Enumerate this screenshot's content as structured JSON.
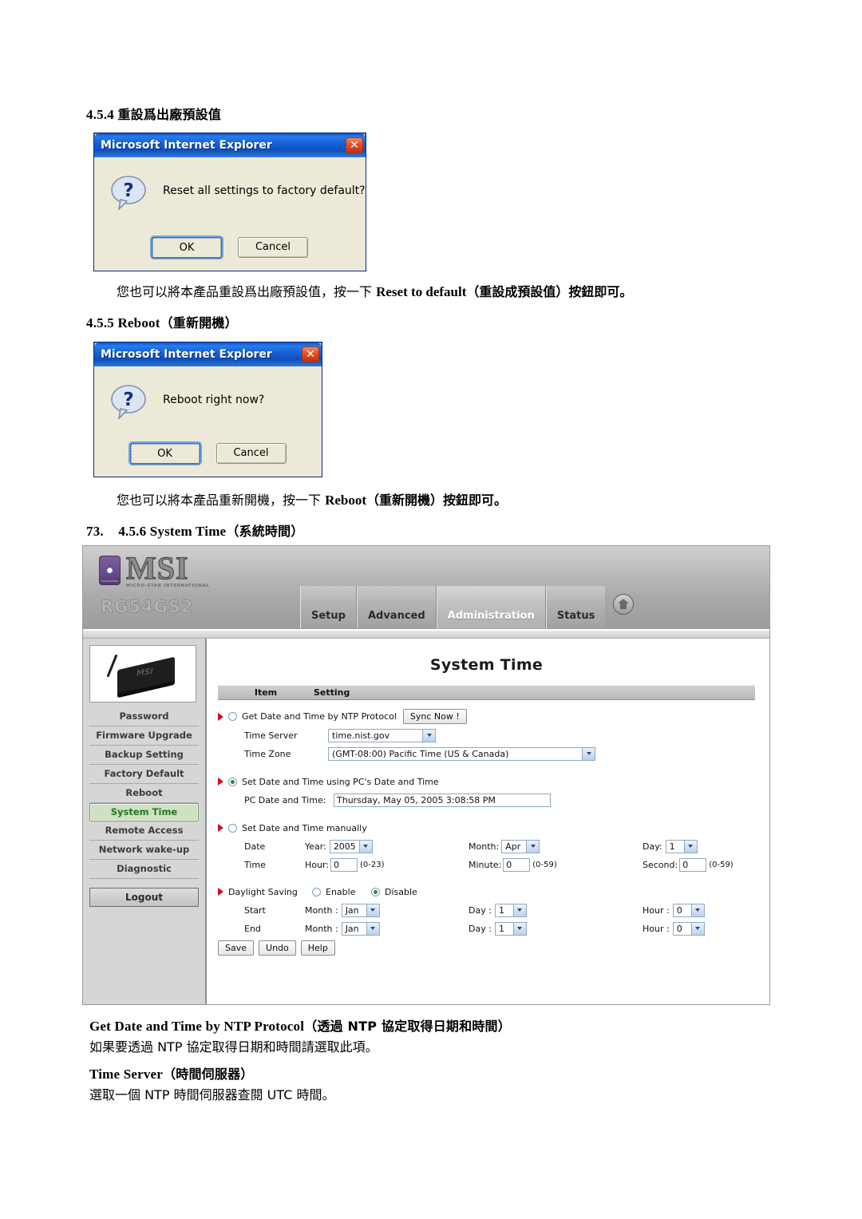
{
  "document": {
    "section_454_heading": "4.5.4 ",
    "section_454_heading_cjk": "重設爲出廠預設值",
    "para_454": "您也可以將本產品重設爲出廠預設值，按一下 ",
    "para_454_bold": "Reset to default",
    "para_454_tail": "（重設成預設值）按鈕即可。",
    "section_455_heading": "4.5.5 Reboot",
    "section_455_heading_cjk": "（重新開機）",
    "para_455": "您也可以將本產品重新開機，按一下 ",
    "para_455_bold": "Reboot",
    "para_455_tail": "（重新開機）按鈕即可。",
    "section_456_number": "73.",
    "section_456_heading": "4.5.6 System Time",
    "section_456_heading_cjk": "（系統時間）",
    "desc1_title": "Get Date and Time by NTP Protocol",
    "desc1_title_cjk": "（透過 NTP 協定取得日期和時間）",
    "desc1_body": "如果要透過 NTP 協定取得日期和時間請選取此項。",
    "desc2_title": "Time Server",
    "desc2_title_cjk": "（時間伺服器）",
    "desc2_body": "選取一個 NTP 時間伺服器查閱 UTC 時間。"
  },
  "dialog_reset": {
    "title": "Microsoft Internet Explorer",
    "close_label": "✕",
    "message": "Reset all settings to factory default?",
    "ok_label": "OK",
    "cancel_label": "Cancel",
    "icon": "question-icon"
  },
  "dialog_reboot": {
    "title": "Microsoft Internet Explorer",
    "close_label": "✕",
    "message": "Reboot right now?",
    "ok_label": "OK",
    "cancel_label": "Cancel",
    "icon": "question-icon"
  },
  "router": {
    "brand": "MSI",
    "brand_sub": "MICRO-STAR INTERNATIONAL",
    "model": "RG54GS2",
    "nav": [
      {
        "label": "Setup",
        "active": false
      },
      {
        "label": "Advanced",
        "active": false
      },
      {
        "label": "Administration",
        "active": true
      },
      {
        "label": "Status",
        "active": false
      }
    ],
    "home_icon": "home-icon",
    "sidebar": {
      "device_image_label": "MSI",
      "items": [
        {
          "label": "Password",
          "active": false
        },
        {
          "label": "Firmware Upgrade",
          "active": false
        },
        {
          "label": "Backup Setting",
          "active": false
        },
        {
          "label": "Factory Default",
          "active": false
        },
        {
          "label": "Reboot",
          "active": false
        },
        {
          "label": "System Time",
          "active": true
        },
        {
          "label": "Remote Access",
          "active": false
        },
        {
          "label": "Network wake-up",
          "active": false
        },
        {
          "label": "Diagnostic",
          "active": false
        }
      ],
      "logout_label": "Logout"
    },
    "page_title": "System Time",
    "table_header": {
      "item": "Item",
      "setting": "Setting"
    },
    "ntp": {
      "label": "Get Date and Time by NTP Protocol",
      "selected": false,
      "sync_button": "Sync Now !",
      "time_server_label": "Time Server",
      "time_server_value": "time.nist.gov",
      "time_zone_label": "Time Zone",
      "time_zone_value": "(GMT-08:00) Pacific Time (US & Canada)"
    },
    "pc_time": {
      "label": "Set Date and Time using PC's Date and Time",
      "selected": true,
      "field_label": "PC Date and Time:",
      "value": "Thursday, May 05, 2005 3:08:58 PM"
    },
    "manual": {
      "label": "Set Date and Time manually",
      "selected": false,
      "date_label": "Date",
      "year_label": "Year:",
      "year_value": "2005",
      "month_label": "Month:",
      "month_value": "Apr",
      "day_label": "Day:",
      "day_value": "1",
      "time_label": "Time",
      "hour_label": "Hour:",
      "hour_value": "0",
      "hour_hint": "(0-23)",
      "minute_label": "Minute:",
      "minute_value": "0",
      "minute_hint": "(0-59)",
      "second_label": "Second:",
      "second_value": "0",
      "second_hint": "(0-59)"
    },
    "daylight": {
      "label": "Daylight Saving",
      "enable_label": "Enable",
      "disable_label": "Disable",
      "enabled_selected": false,
      "disabled_selected": true,
      "start_label": "Start",
      "start_month_label": "Month :",
      "start_month_value": "Jan",
      "start_day_label": "Day :",
      "start_day_value": "1",
      "start_hour_label": "Hour :",
      "start_hour_value": "0",
      "end_label": "End",
      "end_month_label": "Month :",
      "end_month_value": "Jan",
      "end_day_label": "Day :",
      "end_day_value": "1",
      "end_hour_label": "Hour :",
      "end_hour_value": "0"
    },
    "buttons": {
      "save": "Save",
      "undo": "Undo",
      "help": "Help"
    },
    "colors": {
      "active_menu_text": "#1f7a1f",
      "arrow_red": "#cc1111",
      "header_gray": "#b9b9b9"
    }
  }
}
